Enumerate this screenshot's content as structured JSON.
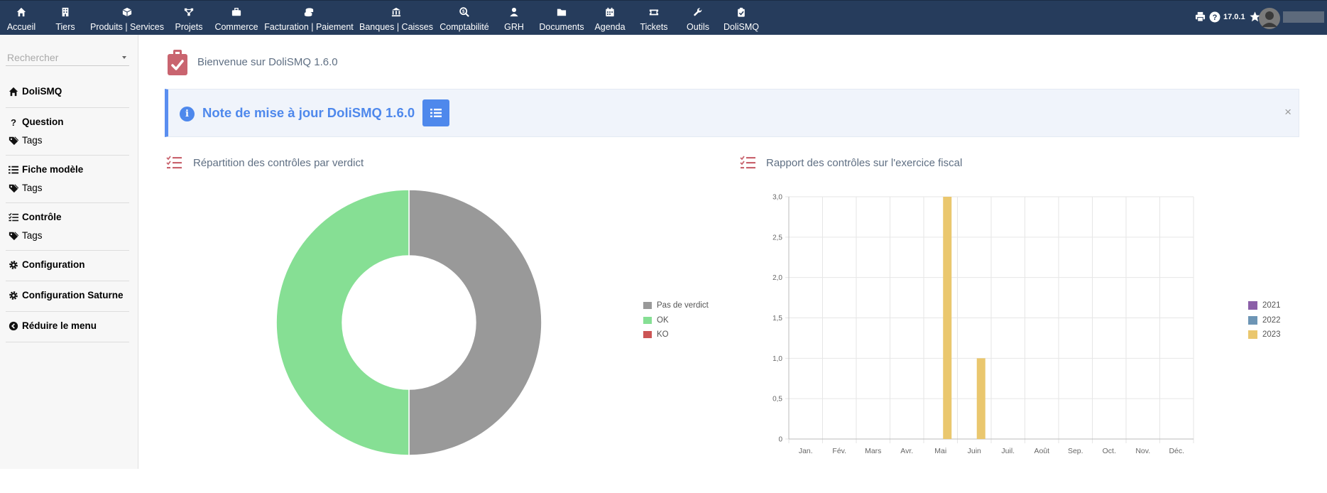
{
  "topmenu": [
    {
      "label": "Accueil",
      "icon": "home-icon",
      "cx": 30
    },
    {
      "label": "Tiers",
      "icon": "building-icon",
      "cx": 92
    },
    {
      "label": "Produits | Services",
      "icon": "cube-icon",
      "cx": 179
    },
    {
      "label": "Projets",
      "icon": "sitemap-icon",
      "cx": 266
    },
    {
      "label": "Commerce",
      "icon": "briefcase-icon",
      "cx": 333
    },
    {
      "label": "Facturation | Paiement",
      "icon": "coins-icon",
      "cx": 435
    },
    {
      "label": "Banques | Caisses",
      "icon": "bank-icon",
      "cx": 558
    },
    {
      "label": "Comptabilité",
      "icon": "search-dollar-icon",
      "cx": 654
    },
    {
      "label": "GRH",
      "icon": "user-icon",
      "cx": 724
    },
    {
      "label": "Documents",
      "icon": "folder-icon",
      "cx": 791
    },
    {
      "label": "Agenda",
      "icon": "calendar-icon",
      "cx": 859
    },
    {
      "label": "Tickets",
      "icon": "ticket-icon",
      "cx": 921
    },
    {
      "label": "Outils",
      "icon": "wrench-icon",
      "cx": 983
    },
    {
      "label": "DoliSMQ",
      "icon": "clipboard-check-icon",
      "cx": 1044,
      "active": true
    }
  ],
  "version": "17.0.1",
  "sidebar": {
    "search_placeholder": "Rechercher",
    "blocks": [
      {
        "rows": [
          {
            "label": "DoliSMQ",
            "icon": "home-icon",
            "bold": true
          }
        ]
      },
      {
        "rows": [
          {
            "label": "Question",
            "icon": "question-icon",
            "bold": true
          },
          {
            "label": "Tags",
            "icon": "tags-icon",
            "bold": false
          }
        ]
      },
      {
        "rows": [
          {
            "label": "Fiche modèle",
            "icon": "list-icon",
            "bold": true
          },
          {
            "label": "Tags",
            "icon": "tags-icon",
            "bold": false
          }
        ]
      },
      {
        "rows": [
          {
            "label": "Contrôle",
            "icon": "tasks-icon",
            "bold": true
          },
          {
            "label": "Tags",
            "icon": "tags-icon",
            "bold": false
          }
        ]
      },
      {
        "rows": [
          {
            "label": "Configuration",
            "icon": "gear-icon",
            "bold": true
          }
        ]
      },
      {
        "rows": [
          {
            "label": "Configuration Saturne",
            "icon": "gear-icon",
            "bold": true
          }
        ]
      },
      {
        "rows": [
          {
            "label": "Réduire le menu",
            "icon": "chevron-circle-left-icon",
            "bold": true
          }
        ]
      }
    ]
  },
  "welcome": "Bienvenue sur DoliSMQ 1.6.0",
  "notice": {
    "title": "Note de mise à jour DoliSMQ 1.6.0",
    "close": "×"
  },
  "panels": {
    "left_title": "Répartition des contrôles par verdict",
    "right_title": "Rapport des contrôles sur l'exercice fiscal"
  },
  "colors": {
    "accent": "#4e88ec",
    "topbar": "#263c5c",
    "brand_red": "#c05461"
  },
  "chart_data": [
    {
      "type": "pie",
      "labels": [
        "Pas de verdict",
        "OK",
        "KO"
      ],
      "values": [
        1,
        1,
        0
      ],
      "colors": [
        "#999999",
        "#86df94",
        "#cc5555"
      ],
      "legend_position": "right"
    },
    {
      "type": "bar",
      "categories": [
        "Jan.",
        "Fév.",
        "Mars",
        "Avr.",
        "Mai",
        "Juin",
        "Juil.",
        "Août",
        "Sep.",
        "Oct.",
        "Nov.",
        "Déc."
      ],
      "series": [
        {
          "name": "2021",
          "color": "#8b5fa8",
          "values": [
            0,
            0,
            0,
            0,
            0,
            0,
            0,
            0,
            0,
            0,
            0,
            0
          ]
        },
        {
          "name": "2022",
          "color": "#6d95b5",
          "values": [
            0,
            0,
            0,
            0,
            0,
            0,
            0,
            0,
            0,
            0,
            0,
            0
          ]
        },
        {
          "name": "2023",
          "color": "#eac76e",
          "values": [
            0,
            0,
            0,
            0,
            3,
            1,
            0,
            0,
            0,
            0,
            0,
            0
          ]
        }
      ],
      "ylim": [
        0,
        3
      ],
      "yticks": [
        "0",
        "0,5",
        "1,0",
        "1,5",
        "2,0",
        "2,5",
        "3,0"
      ],
      "grid": true,
      "legend_position": "right"
    }
  ]
}
